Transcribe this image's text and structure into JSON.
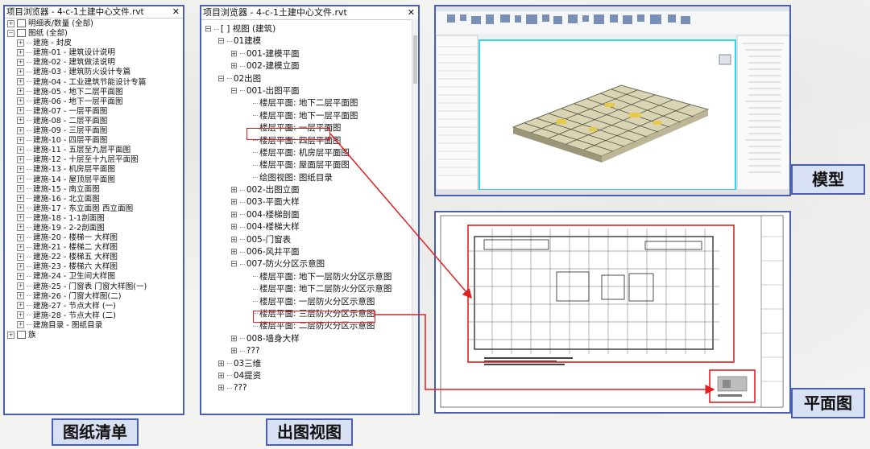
{
  "panel1": {
    "title": "项目浏览器 - 4-c-1土建中心文件.rvt",
    "close": "✕",
    "schedules": "明细表/数量 (全部)",
    "sheets": "图纸 (全部)",
    "items": [
      "建施 - 封皮",
      "建施-01 - 建筑设计说明",
      "建施-02 - 建筑做法说明",
      "建施-03 - 建筑防火设计专篇",
      "建施-04 - 工业建筑节能设计专篇",
      "建施-05 - 地下二层平面图",
      "建施-06 - 地下一层平面图",
      "建施-07 - 一层平面图",
      "建施-08 - 二层平面图",
      "建施-09 - 三层平面图",
      "建施-10 - 四层平面图",
      "建施-11 - 五层至九层平面图",
      "建施-12 - 十层至十九层平面图",
      "建施-13 - 机房层平面图",
      "建施-14 - 屋顶层平面图",
      "建施-15 - 南立面图",
      "建施-16 - 北立面图",
      "建施-17 - 东立面图    西立面图",
      "建施-18 - 1-1剖面图",
      "建施-19 - 2-2剖面图",
      "建施-20 - 楼梯一 大样图",
      "建施-21 - 楼梯二 大样图",
      "建施-22 - 楼梯五 大样图",
      "建施-23 - 楼梯六 大样图",
      "建施-24 - 卫生间大样图",
      "建施-25 - 门窗表 门窗大样图(一)",
      "建施-26 - 门窗大样图(二)",
      "建施-27 - 节点大样 (一)",
      "建施-28 - 节点大样 (二)",
      "建施目录 - 图纸目录"
    ],
    "family": "族",
    "caption": "图纸清单"
  },
  "panel2": {
    "title": "项目浏览器 - 4-c-1土建中心文件.rvt",
    "close": "✕",
    "rows": [
      {
        "indent": 0,
        "toggle": "⊟",
        "text": "[ ]  视图 (建筑)"
      },
      {
        "indent": 1,
        "toggle": "⊟",
        "text": "01建模"
      },
      {
        "indent": 2,
        "toggle": "⊞",
        "text": "001-建模平面"
      },
      {
        "indent": 2,
        "toggle": "⊞",
        "text": "002-建模立面"
      },
      {
        "indent": 1,
        "toggle": "⊟",
        "text": "02出图"
      },
      {
        "indent": 2,
        "toggle": "⊟",
        "text": "001-出图平面"
      },
      {
        "indent": 3,
        "toggle": "",
        "text": "楼层平面: 地下二层平面图"
      },
      {
        "indent": 3,
        "toggle": "",
        "text": "楼层平面: 地下一层平面图"
      },
      {
        "indent": 3,
        "toggle": "",
        "text": "楼层平面: 一层平面图"
      },
      {
        "indent": 3,
        "toggle": "",
        "text": "楼层平面: 四层平面图"
      },
      {
        "indent": 3,
        "toggle": "",
        "text": "楼层平面: 机房层平面图"
      },
      {
        "indent": 3,
        "toggle": "",
        "text": "楼层平面: 屋面层平面图"
      },
      {
        "indent": 3,
        "toggle": "",
        "text": "绘图视图: 图纸目录"
      },
      {
        "indent": 2,
        "toggle": "⊞",
        "text": "002-出图立面"
      },
      {
        "indent": 2,
        "toggle": "⊞",
        "text": "003-平面大样"
      },
      {
        "indent": 2,
        "toggle": "⊞",
        "text": "004-楼梯剖面"
      },
      {
        "indent": 2,
        "toggle": "⊞",
        "text": "004-楼梯大样"
      },
      {
        "indent": 2,
        "toggle": "⊞",
        "text": "005-门窗表"
      },
      {
        "indent": 2,
        "toggle": "⊞",
        "text": "006-风井平面"
      },
      {
        "indent": 2,
        "toggle": "⊟",
        "text": "007-防火分区示意图"
      },
      {
        "indent": 3,
        "toggle": "",
        "text": "楼层平面: 地下一层防火分区示意图"
      },
      {
        "indent": 3,
        "toggle": "",
        "text": "楼层平面: 地下二层防火分区示意图"
      },
      {
        "indent": 3,
        "toggle": "",
        "text": "楼层平面: 一层防火分区示意图"
      },
      {
        "indent": 3,
        "toggle": "",
        "text": "楼层平面: 三层防火分区示意图"
      },
      {
        "indent": 3,
        "toggle": "",
        "text": "楼层平面: 二层防火分区示意图"
      },
      {
        "indent": 2,
        "toggle": "⊞",
        "text": "008-墙身大样"
      },
      {
        "indent": 2,
        "toggle": "⊞",
        "text": "???"
      },
      {
        "indent": 1,
        "toggle": "⊞",
        "text": "03三维"
      },
      {
        "indent": 1,
        "toggle": "⊞",
        "text": "04提资"
      },
      {
        "indent": 1,
        "toggle": "⊞",
        "text": "???"
      }
    ],
    "caption": "出图视图"
  },
  "model": {
    "caption": "模型"
  },
  "plan": {
    "caption": "平面图"
  },
  "colors": {
    "frame": "#4a5fb0",
    "highlight": "#e21f1f",
    "caption_bg": "#d8e1f3"
  }
}
